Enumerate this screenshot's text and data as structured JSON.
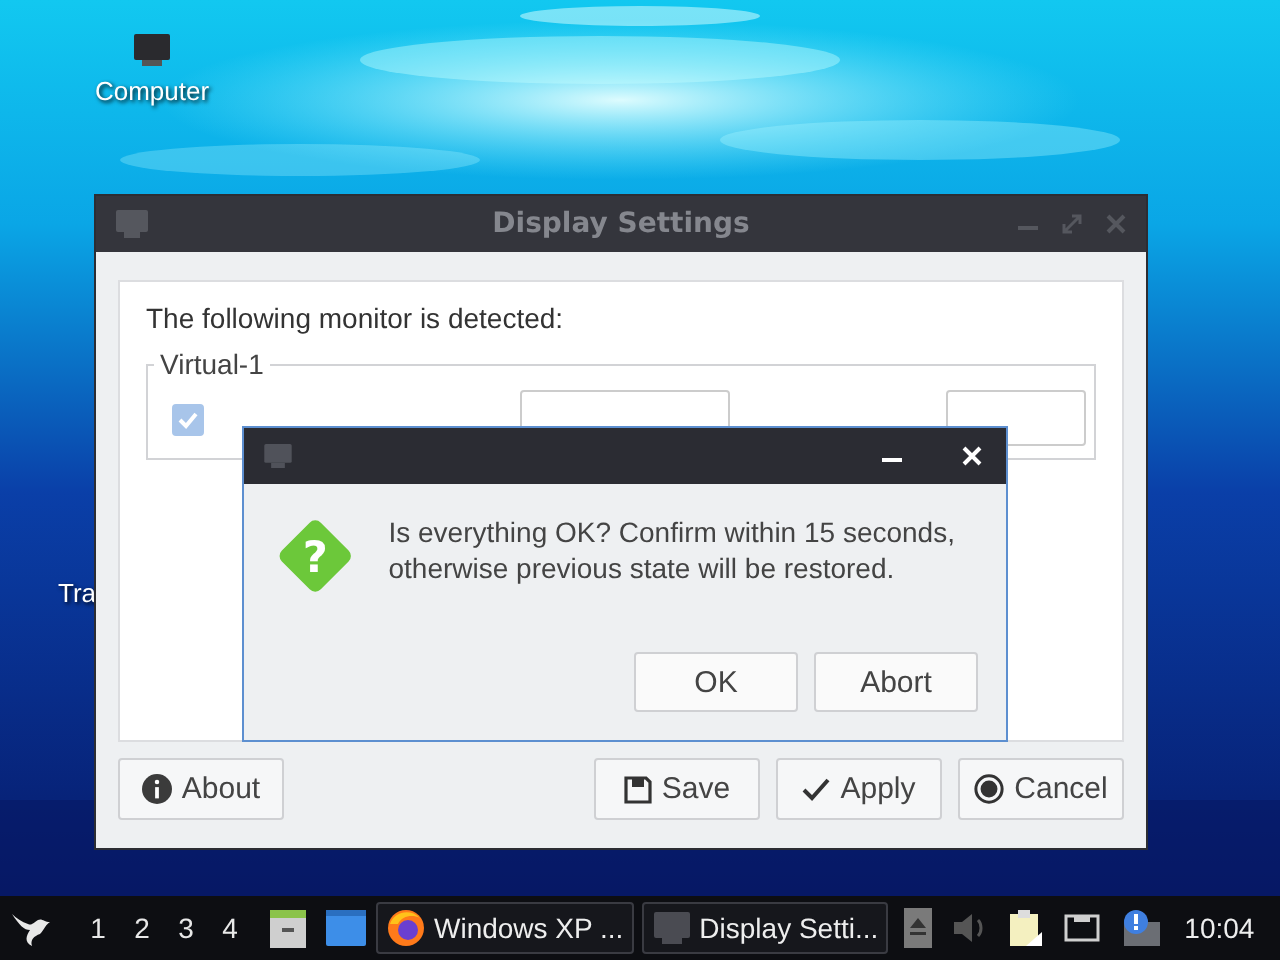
{
  "desktop": {
    "icons": [
      {
        "label": "Computer",
        "kind": "computer"
      },
      {
        "label": "Tra",
        "kind": "hidden"
      }
    ]
  },
  "main_window": {
    "title": "Display Settings",
    "intro": "The following monitor is detected:",
    "monitor": {
      "name": "Virtual-1",
      "turn_on": {
        "checked": true,
        "disabled": true
      }
    },
    "buttons": [
      {
        "label": "About",
        "kind": "info"
      },
      {
        "label": "Save",
        "kind": "save"
      },
      {
        "label": "Apply",
        "kind": "apply"
      },
      {
        "label": "Cancel",
        "kind": "cancel"
      }
    ]
  },
  "dialog": {
    "icon_glyph": "?",
    "message": "Is everything OK? Confirm within 15 seconds, otherwise previous state will be restored.",
    "buttons": [
      "OK",
      "Abort"
    ]
  },
  "taskbar": {
    "workspaces": [
      "1",
      "2",
      "3",
      "4"
    ],
    "tasks": [
      {
        "label": "Windows XP ...",
        "kind": "browser"
      },
      {
        "label": "Display Setti...",
        "kind": "window"
      }
    ],
    "clock": "10:04"
  }
}
